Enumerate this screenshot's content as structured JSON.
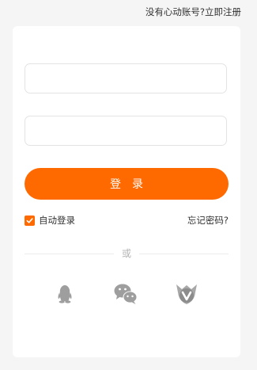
{
  "header": {
    "no_account_text": "没有心动账号?",
    "register_label": "立即注册"
  },
  "form": {
    "username": {
      "value": "",
      "placeholder": ""
    },
    "password": {
      "value": "",
      "placeholder": ""
    },
    "login_button_label": "登录",
    "auto_login_label": "自动登录",
    "auto_login_checked": true,
    "forgot_password_label": "忘记密码?",
    "divider_label": "或"
  },
  "social_logins": [
    {
      "name": "qq",
      "icon": "qq-penguin-icon"
    },
    {
      "name": "wechat",
      "icon": "wechat-bubbles-icon"
    },
    {
      "name": "weibo",
      "icon": "v-badge-icon"
    }
  ],
  "colors": {
    "accent": "#ff6a00",
    "background": "#f5f5f5",
    "card": "#ffffff",
    "social_icon": "#9e9e9e",
    "divider_text": "#b3b3b3"
  }
}
